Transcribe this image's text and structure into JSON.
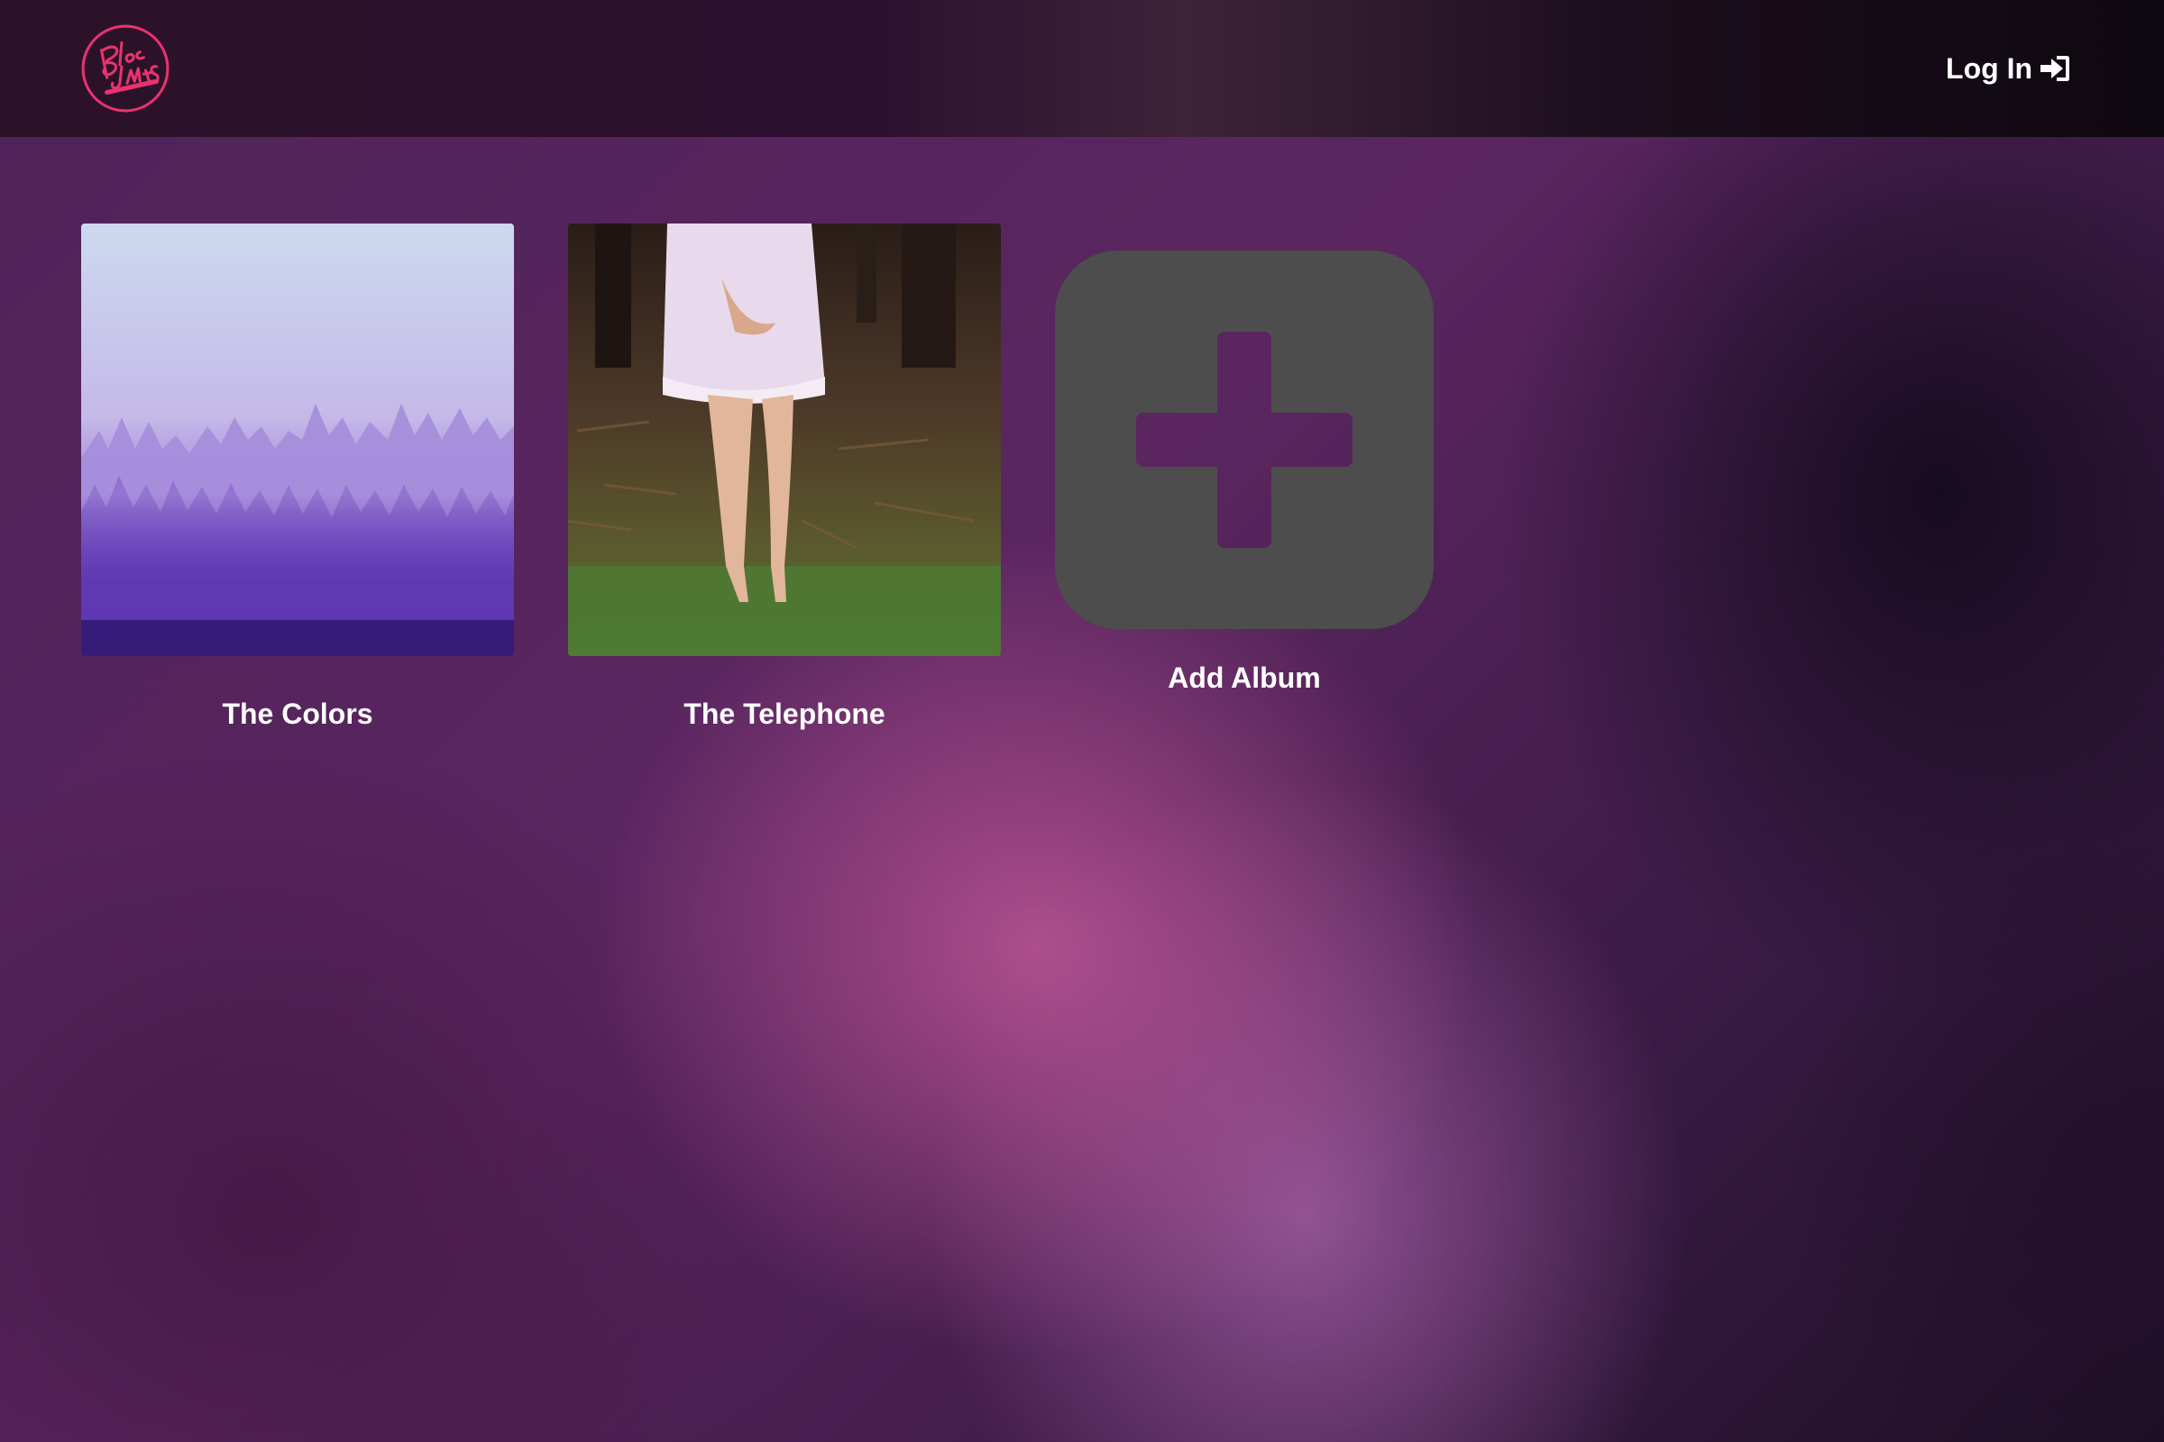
{
  "brand": {
    "logo_text": "Bloc Jams",
    "logo_color": "#e8336e"
  },
  "header": {
    "login_label": "Log In",
    "login_icon": "sign-in-icon"
  },
  "albums": [
    {
      "title": "The Colors",
      "cover": "misty-purple-forest-image"
    },
    {
      "title": "The Telephone",
      "cover": "girl-in-white-dress-forest-image"
    }
  ],
  "add_album": {
    "label": "Add Album",
    "icon": "plus-square-icon",
    "tile_color": "#4d4d4d"
  },
  "colors": {
    "navbar": "#2b1228",
    "background_accent": "#b85590",
    "text": "#ffffff"
  }
}
